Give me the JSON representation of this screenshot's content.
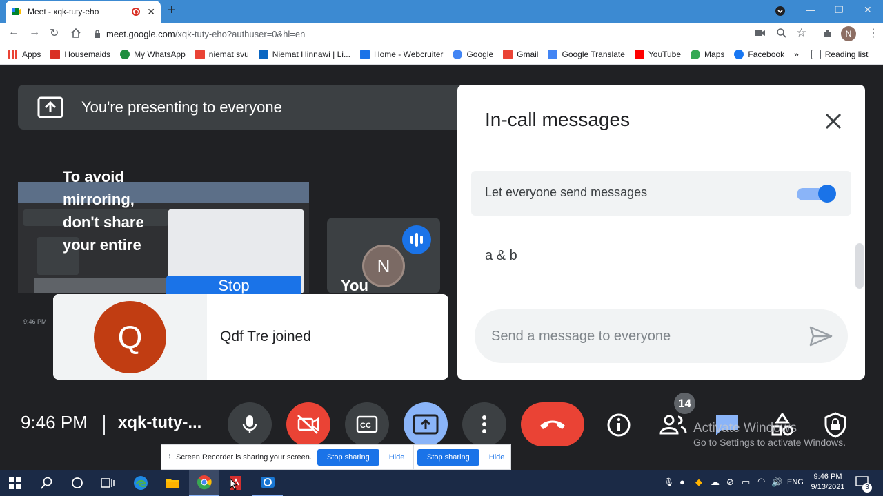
{
  "browser": {
    "tab_title": "Meet - xqk-tuty-eho",
    "url_host": "meet.google.com",
    "url_path": "/xqk-tuty-eho?authuser=0&hl=en",
    "profile_initial": "N"
  },
  "bookmarks": [
    {
      "label": "Apps",
      "color": "#5f6368"
    },
    {
      "label": "Housemaids",
      "color": "#d93025"
    },
    {
      "label": "My WhatsApp",
      "color": "#1e8e3e"
    },
    {
      "label": "niemat svu",
      "color": "#ea4335"
    },
    {
      "label": "Niemat Hinnawi | Li...",
      "color": "#0a66c2"
    },
    {
      "label": "Home - Webcruiter",
      "color": "#1a73e8"
    },
    {
      "label": "Google",
      "color": "#4285f4"
    },
    {
      "label": "Gmail",
      "color": "#ea4335"
    },
    {
      "label": "Google Translate",
      "color": "#4285f4"
    },
    {
      "label": "YouTube",
      "color": "#ff0000"
    },
    {
      "label": "Maps",
      "color": "#34a853"
    },
    {
      "label": "Facebook",
      "color": "#1877f2"
    }
  ],
  "bookmarks_more": "»",
  "reading_list": "Reading list",
  "meet": {
    "presenting_banner": "You're presenting to everyone",
    "mirror_warning": "To avoid mirroring, don't share your entire",
    "stop_label": "Stop",
    "you_label": "You",
    "you_initial": "N",
    "toast": {
      "initial": "Q",
      "message": "Qdf Tre joined"
    },
    "clock": "9:46 PM",
    "meeting_code": "xqk-tuty-...",
    "participant_count": "14"
  },
  "chat": {
    "title": "In-call messages",
    "permission_label": "Let everyone send messages",
    "permission_enabled": true,
    "messages": [
      "a & b"
    ],
    "input_placeholder": "Send a message to everyone"
  },
  "watermark": {
    "line1": "Activate Windows",
    "line2": "Go to Settings to activate Windows."
  },
  "screen_share": {
    "notice": "Screen Recorder is sharing your screen.",
    "stop_label": "Stop sharing",
    "hide_label": "Hide"
  },
  "taskbar": {
    "time": "9:46 PM",
    "date": "9/13/2021",
    "language": "ENG",
    "notification_count": "3"
  },
  "colors": {
    "accent_blue": "#1a73e8",
    "hangup_red": "#ea4335",
    "meet_bg": "#202124"
  }
}
